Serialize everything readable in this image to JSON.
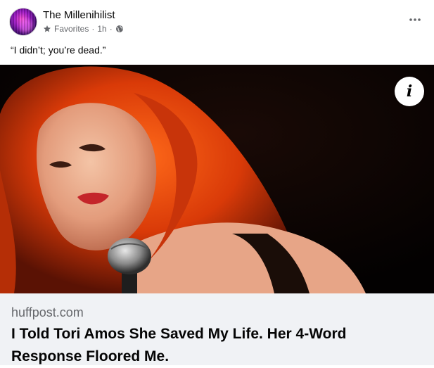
{
  "post": {
    "page_name": "The Millenihilist",
    "audience": "Favorites",
    "separator_1": "·",
    "time": "1h",
    "separator_2": "·",
    "caption": "“I didn’t; you’re dead.”"
  },
  "icons": {
    "audience": "star-icon",
    "privacy": "globe-icon",
    "menu": "more-horizontal-icon",
    "info": "info-icon"
  },
  "link": {
    "domain": "huffpost.com",
    "title": "I Told Tori Amos She Saved My Life. Her 4-Word Response Floored Me.",
    "info_glyph": "i"
  },
  "colors": {
    "secondary_text": "#65676b",
    "footer_background": "#f0f2f5",
    "primary_text": "#050505"
  }
}
